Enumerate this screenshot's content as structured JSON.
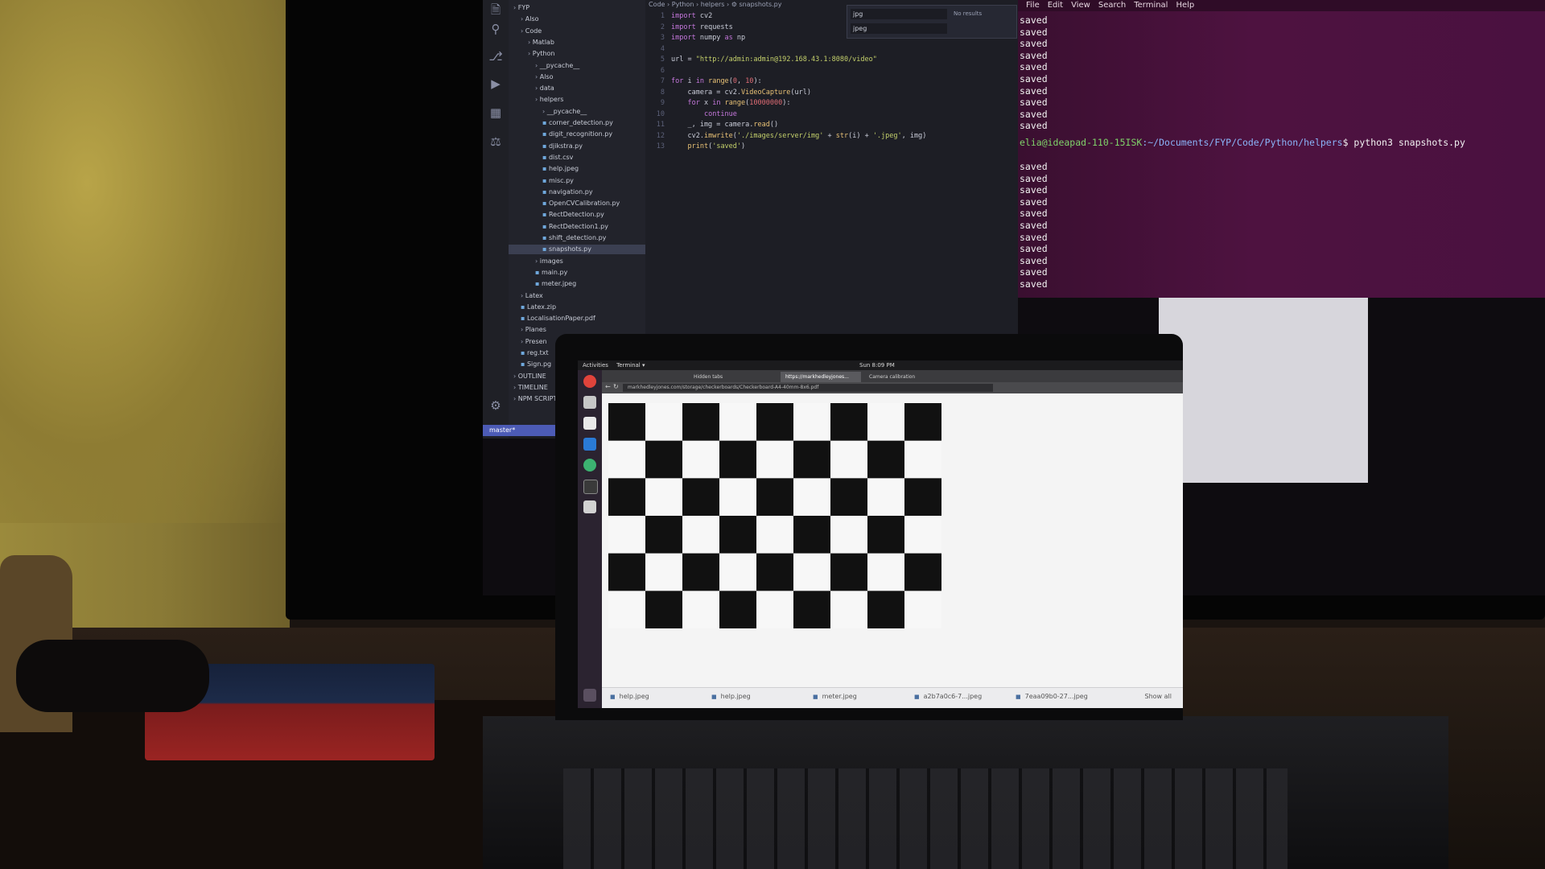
{
  "vscode": {
    "breadcrumb": "Code › Python › helpers › ⚙ snapshots.py",
    "explorer_items": [
      {
        "label": "FYP",
        "indent": 0,
        "folder": true
      },
      {
        "label": "Also",
        "indent": 1,
        "folder": true
      },
      {
        "label": "Code",
        "indent": 1,
        "folder": true
      },
      {
        "label": "Matlab",
        "indent": 2,
        "folder": true
      },
      {
        "label": "Python",
        "indent": 2,
        "folder": true
      },
      {
        "label": "__pycache__",
        "indent": 3,
        "folder": true
      },
      {
        "label": "Also",
        "indent": 3,
        "folder": true
      },
      {
        "label": "data",
        "indent": 3,
        "folder": true
      },
      {
        "label": "helpers",
        "indent": 3,
        "folder": true
      },
      {
        "label": "__pycache__",
        "indent": 4,
        "folder": true
      },
      {
        "label": "corner_detection.py",
        "indent": 4,
        "folder": false
      },
      {
        "label": "digit_recognition.py",
        "indent": 4,
        "folder": false
      },
      {
        "label": "djikstra.py",
        "indent": 4,
        "folder": false
      },
      {
        "label": "dist.csv",
        "indent": 4,
        "folder": false
      },
      {
        "label": "help.jpeg",
        "indent": 4,
        "folder": false
      },
      {
        "label": "misc.py",
        "indent": 4,
        "folder": false
      },
      {
        "label": "navigation.py",
        "indent": 4,
        "folder": false
      },
      {
        "label": "OpenCVCalibration.py",
        "indent": 4,
        "folder": false
      },
      {
        "label": "RectDetection.py",
        "indent": 4,
        "folder": false
      },
      {
        "label": "RectDetection1.py",
        "indent": 4,
        "folder": false
      },
      {
        "label": "shift_detection.py",
        "indent": 4,
        "folder": false
      },
      {
        "label": "snapshots.py",
        "indent": 4,
        "folder": false,
        "selected": true
      },
      {
        "label": "images",
        "indent": 3,
        "folder": true
      },
      {
        "label": "main.py",
        "indent": 3,
        "folder": false
      },
      {
        "label": "meter.jpeg",
        "indent": 3,
        "folder": false
      },
      {
        "label": "Latex",
        "indent": 1,
        "folder": true
      },
      {
        "label": "Latex.zip",
        "indent": 1,
        "folder": false
      },
      {
        "label": "LocalisationPaper.pdf",
        "indent": 1,
        "folder": false
      },
      {
        "label": "Planes",
        "indent": 1,
        "folder": true
      },
      {
        "label": "Presen",
        "indent": 1,
        "folder": true
      },
      {
        "label": "reg.txt",
        "indent": 1,
        "folder": false
      },
      {
        "label": "Sign.pg",
        "indent": 1,
        "folder": false
      },
      {
        "label": "OUTLINE",
        "indent": 0,
        "folder": true
      },
      {
        "label": "TIMELINE",
        "indent": 0,
        "folder": true
      },
      {
        "label": "NPM SCRIPTS",
        "indent": 0,
        "folder": true
      }
    ],
    "code_lines": [
      {
        "n": "1",
        "parts": [
          [
            "kw",
            "import"
          ],
          [
            "pl",
            " cv2"
          ]
        ]
      },
      {
        "n": "2",
        "parts": [
          [
            "kw",
            "import"
          ],
          [
            "pl",
            " requests"
          ]
        ]
      },
      {
        "n": "3",
        "parts": [
          [
            "kw",
            "import"
          ],
          [
            "pl",
            " numpy "
          ],
          [
            "kw",
            "as"
          ],
          [
            "pl",
            " np"
          ]
        ]
      },
      {
        "n": "4",
        "parts": []
      },
      {
        "n": "5",
        "parts": [
          [
            "pl",
            "url = "
          ],
          [
            "st",
            "\"http://admin:admin@192.168.43.1:8080/video\""
          ]
        ]
      },
      {
        "n": "6",
        "parts": []
      },
      {
        "n": "7",
        "parts": [
          [
            "kw",
            "for"
          ],
          [
            "pl",
            " i "
          ],
          [
            "kw",
            "in"
          ],
          [
            "fn",
            " range"
          ],
          [
            "pl",
            "("
          ],
          [
            "nm",
            "0"
          ],
          [
            "pl",
            ", "
          ],
          [
            "nm",
            "10"
          ],
          [
            "pl",
            "):"
          ]
        ]
      },
      {
        "n": "8",
        "parts": [
          [
            "pl",
            "    camera = cv2."
          ],
          [
            "fn",
            "VideoCapture"
          ],
          [
            "pl",
            "(url)"
          ]
        ]
      },
      {
        "n": "9",
        "parts": [
          [
            "pl",
            "    "
          ],
          [
            "kw",
            "for"
          ],
          [
            "pl",
            " x "
          ],
          [
            "kw",
            "in"
          ],
          [
            "fn",
            " range"
          ],
          [
            "pl",
            "("
          ],
          [
            "nm",
            "10000000"
          ],
          [
            "pl",
            "):"
          ]
        ]
      },
      {
        "n": "10",
        "parts": [
          [
            "pl",
            "        "
          ],
          [
            "kw",
            "continue"
          ]
        ]
      },
      {
        "n": "11",
        "parts": [
          [
            "pl",
            "    _, img = camera."
          ],
          [
            "fn",
            "read"
          ],
          [
            "pl",
            "()"
          ]
        ]
      },
      {
        "n": "12",
        "parts": [
          [
            "pl",
            "    cv2."
          ],
          [
            "fn",
            "imwrite"
          ],
          [
            "pl",
            "("
          ],
          [
            "st",
            "'./images/server/img'"
          ],
          [
            "pl",
            " + "
          ],
          [
            "fn",
            "str"
          ],
          [
            "pl",
            "(i) + "
          ],
          [
            "st",
            "'.jpeg'"
          ],
          [
            "pl",
            ", img)"
          ]
        ]
      },
      {
        "n": "13",
        "parts": [
          [
            "pl",
            "    "
          ],
          [
            "fn",
            "print"
          ],
          [
            "pl",
            "("
          ],
          [
            "st",
            "'saved'"
          ],
          [
            "pl",
            ")"
          ]
        ]
      }
    ],
    "find_query": "jpg",
    "replace_query": "jpeg",
    "find_count": "No results",
    "status_branch": "master*"
  },
  "terminal": {
    "menu": [
      "File",
      "Edit",
      "View",
      "Search",
      "Terminal",
      "Help"
    ],
    "saved_before": [
      "saved",
      "saved",
      "saved",
      "saved",
      "saved",
      "saved",
      "saved",
      "saved",
      "saved",
      "saved"
    ],
    "prompt_user": "elia@ideapad-110-15ISK",
    "prompt_path": ":~/Documents/FYP/Code/Python/helpers",
    "command": "$ python3 snapshots.py",
    "saved_after": [
      "saved",
      "saved",
      "saved",
      "saved",
      "saved",
      "saved",
      "saved",
      "saved",
      "saved",
      "saved",
      "saved"
    ]
  },
  "laptop": {
    "topbar_left": "Activities",
    "topbar_app": "Terminal ▾",
    "topbar_clock": "Sun 8:09 PM",
    "tabs": [
      {
        "label": "",
        "active": false
      },
      {
        "label": "Hidden tabs",
        "active": false
      },
      {
        "label": "https://markhedleyjones...",
        "active": true
      },
      {
        "label": "Camera calibration",
        "active": false
      },
      {
        "label": "",
        "active": false
      }
    ],
    "url": "markhedleyjones.com/storage/checkerboards/Checkerboard-A4-40mm-8x6.pdf",
    "downloads": [
      "help.jpeg",
      "help.jpeg",
      "meter.jpeg",
      "a2b7a0c6-7...jpeg",
      "7eaa09b0-27...jpeg"
    ],
    "show_all": "Show all",
    "checkerboard": {
      "cols": 9,
      "rows": 6
    }
  },
  "colors": {
    "terminal_bg": "#4e1240",
    "vscode_bg": "#1d1e25",
    "checker_dark": "#111111",
    "checker_light": "#f7f7f7",
    "wall": "#9b8a3c"
  }
}
